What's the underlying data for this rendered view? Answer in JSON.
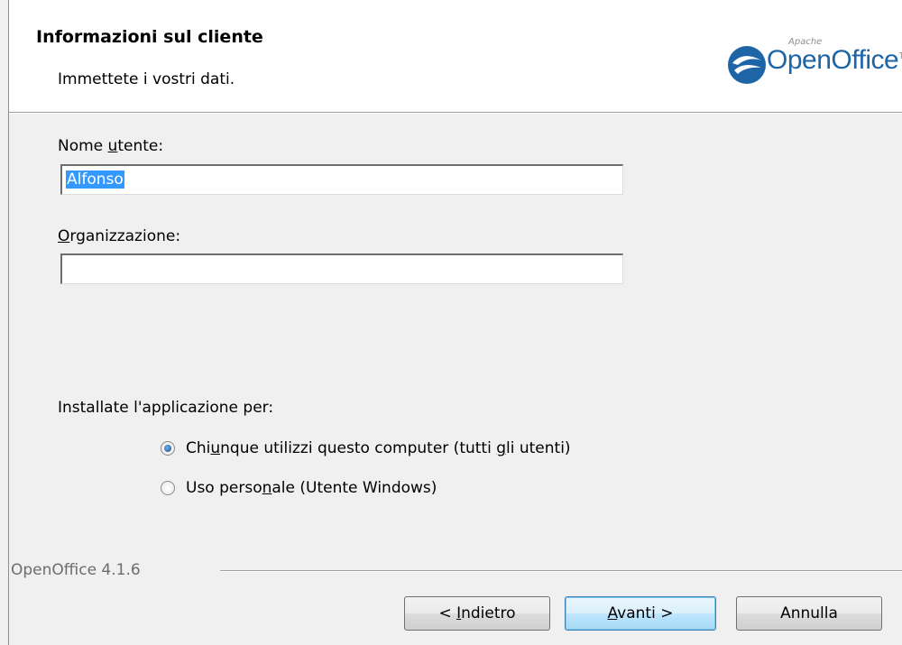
{
  "header": {
    "title": "Informazioni sul cliente",
    "subtitle": "Immettete i vostri dati.",
    "logo_small": "Apache",
    "logo_text": "OpenOffice",
    "logo_tm": "TM"
  },
  "form": {
    "username_label_pre": "Nome ",
    "username_label_key": "u",
    "username_label_post": "tente:",
    "username_value": "Alfonso",
    "org_label_key": "O",
    "org_label_post": "rganizzazione:",
    "org_value": "",
    "install_for_label": "Installate l'applicazione per:",
    "option_all_pre": "Chi",
    "option_all_key": "u",
    "option_all_mid": "nque utilizzi questo computer (tutti ",
    "option_all_key2": "g",
    "option_all_post": "li utenti)",
    "option_all_checked": true,
    "option_personal_pre": "Uso perso",
    "option_personal_key": "n",
    "option_personal_post": "ale (Utente Windows)",
    "option_personal_checked": false
  },
  "footer": {
    "version": "OpenOffice 4.1.6",
    "back_pre": "< ",
    "back_key": "I",
    "back_post": "ndietro",
    "next_key": "A",
    "next_post": "vanti >",
    "cancel_label": "Annulla"
  },
  "colors": {
    "selection": "#3399ff",
    "logo_blue": "#1d65a6",
    "default_button_border": "#3c7fb1"
  },
  "icons": {
    "logo": "openoffice-gull-icon",
    "radio_checked": "radio-checked-icon",
    "radio_unchecked": "radio-unchecked-icon"
  }
}
